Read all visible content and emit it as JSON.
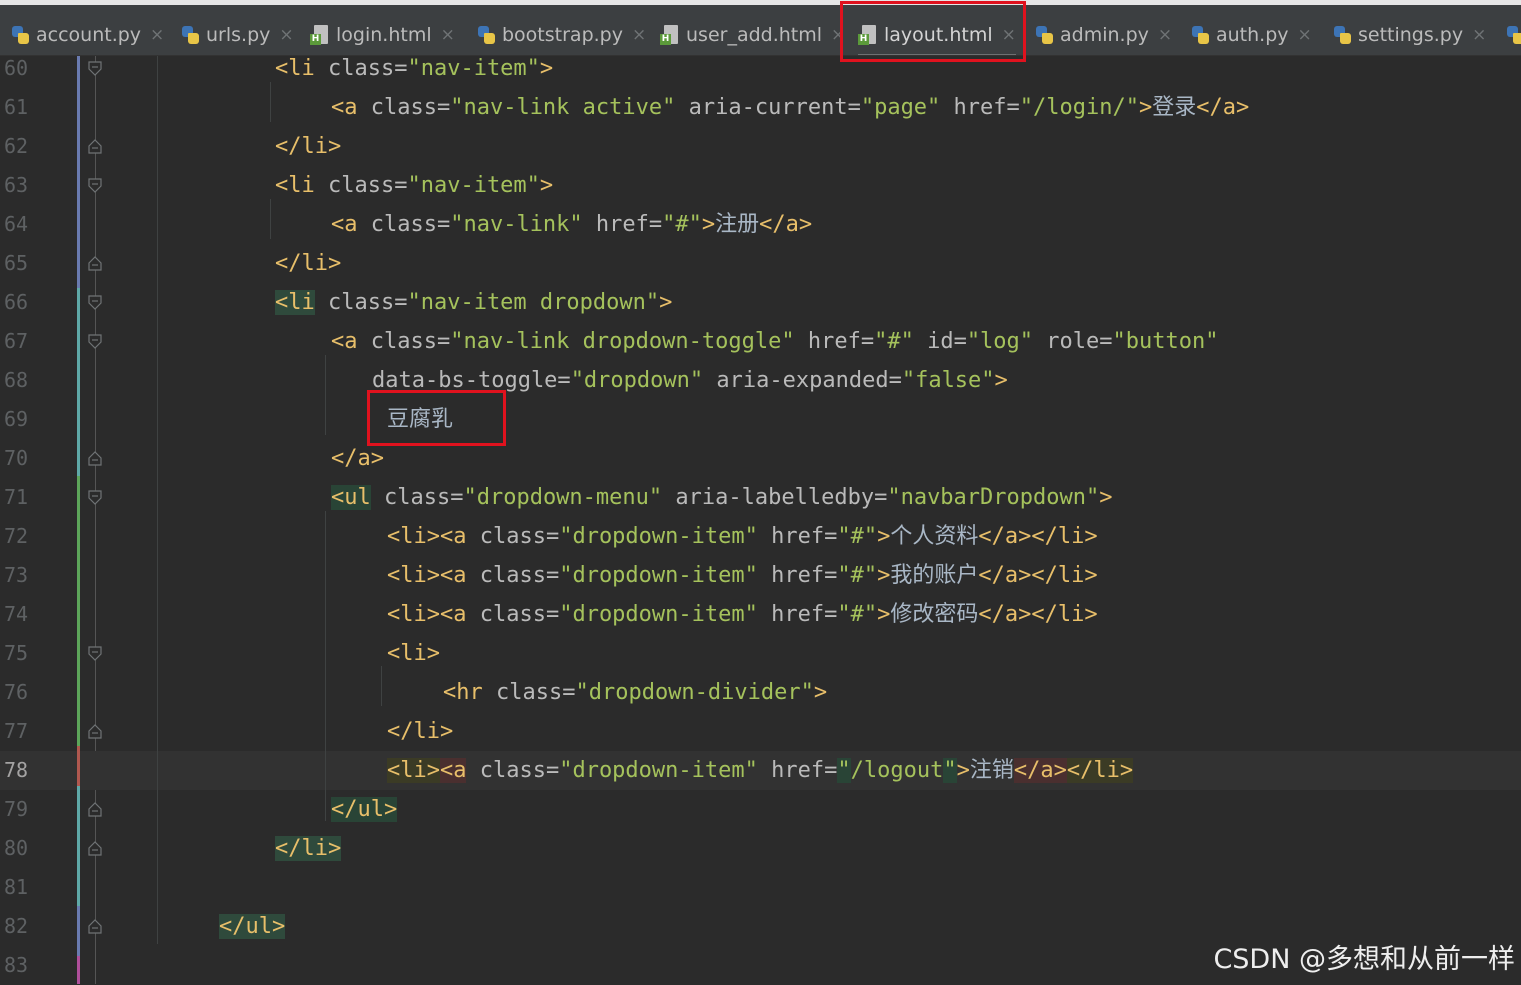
{
  "tabs": [
    {
      "label": "account.py",
      "icon": "python-file-icon",
      "active": false
    },
    {
      "label": "urls.py",
      "icon": "python-file-icon",
      "active": false
    },
    {
      "label": "login.html",
      "icon": "html-file-icon",
      "active": false
    },
    {
      "label": "bootstrap.py",
      "icon": "python-file-icon",
      "active": false
    },
    {
      "label": "user_add.html",
      "icon": "html-file-icon",
      "active": false
    },
    {
      "label": "layout.html",
      "icon": "html-file-icon",
      "active": true
    },
    {
      "label": "admin.py",
      "icon": "python-file-icon",
      "active": false
    },
    {
      "label": "auth.py",
      "icon": "python-file-icon",
      "active": false
    },
    {
      "label": "settings.py",
      "icon": "python-file-icon",
      "active": false
    }
  ],
  "tab_close_glyph": "×",
  "current_line": "78",
  "colors": {
    "highlight_box": "#e0121e",
    "tag": "#e8bf6a",
    "attribute_value": "#a5c25c",
    "attribute": "#bababa"
  },
  "lines": [
    {
      "num": "60",
      "tokens": [
        [
          "tag",
          "<li"
        ],
        [
          "attr",
          " class="
        ],
        [
          "val",
          "\"nav-item\""
        ],
        [
          "tag",
          ">"
        ]
      ]
    },
    {
      "num": "61",
      "tokens": [
        [
          "tag",
          "<a"
        ],
        [
          "attr",
          " class="
        ],
        [
          "val",
          "\"nav-link active\""
        ],
        [
          "attr",
          " aria-current="
        ],
        [
          "val",
          "\"page\""
        ],
        [
          "attr",
          " href="
        ],
        [
          "val",
          "\"/login/\""
        ],
        [
          "tag",
          ">"
        ],
        [
          "txt",
          "登录"
        ],
        [
          "tag",
          "</a>"
        ]
      ]
    },
    {
      "num": "62",
      "tokens": [
        [
          "tag",
          "</li>"
        ]
      ]
    },
    {
      "num": "63",
      "tokens": [
        [
          "tag",
          "<li"
        ],
        [
          "attr",
          " class="
        ],
        [
          "val",
          "\"nav-item\""
        ],
        [
          "tag",
          ">"
        ]
      ]
    },
    {
      "num": "64",
      "tokens": [
        [
          "tag",
          "<a"
        ],
        [
          "attr",
          " class="
        ],
        [
          "val",
          "\"nav-link\""
        ],
        [
          "attr",
          " href="
        ],
        [
          "val",
          "\"#\""
        ],
        [
          "tag",
          ">"
        ],
        [
          "txt",
          "注册"
        ],
        [
          "tag",
          "</a>"
        ]
      ]
    },
    {
      "num": "65",
      "tokens": [
        [
          "tag",
          "</li>"
        ]
      ]
    },
    {
      "num": "66",
      "tokens": [
        [
          "tagbg",
          "<li"
        ],
        [
          "attr",
          " class="
        ],
        [
          "val",
          "\"nav-item dropdown\""
        ],
        [
          "tag",
          ">"
        ]
      ]
    },
    {
      "num": "67",
      "tokens": [
        [
          "tag",
          "<a"
        ],
        [
          "attr",
          " class="
        ],
        [
          "val",
          "\"nav-link dropdown-toggle\""
        ],
        [
          "attr",
          " href="
        ],
        [
          "val",
          "\"#\""
        ],
        [
          "attr",
          " id="
        ],
        [
          "val",
          "\"log\""
        ],
        [
          "attr",
          " role="
        ],
        [
          "val",
          "\"button\""
        ]
      ]
    },
    {
      "num": "68",
      "tokens": [
        [
          "attr",
          "data-bs-toggle="
        ],
        [
          "val",
          "\"dropdown\""
        ],
        [
          "attr",
          " aria-expanded="
        ],
        [
          "val",
          "\"false\""
        ],
        [
          "tag",
          ">"
        ]
      ]
    },
    {
      "num": "69",
      "tokens": [
        [
          "txt",
          "豆腐乳"
        ]
      ]
    },
    {
      "num": "70",
      "tokens": [
        [
          "tag",
          "</a>"
        ]
      ]
    },
    {
      "num": "71",
      "tokens": [
        [
          "tagbg-g",
          "<ul"
        ],
        [
          "attr",
          " class="
        ],
        [
          "val",
          "\"dropdown-menu\""
        ],
        [
          "attr",
          " aria-labelledby="
        ],
        [
          "val",
          "\"navbarDropdown\""
        ],
        [
          "tag",
          ">"
        ]
      ]
    },
    {
      "num": "72",
      "tokens": [
        [
          "tag",
          "<li><a"
        ],
        [
          "attr",
          " class="
        ],
        [
          "val",
          "\"dropdown-item\""
        ],
        [
          "attr",
          " href="
        ],
        [
          "val",
          "\"#\""
        ],
        [
          "tag",
          ">"
        ],
        [
          "txt",
          "个人资料"
        ],
        [
          "tag",
          "</a></li>"
        ]
      ]
    },
    {
      "num": "73",
      "tokens": [
        [
          "tag",
          "<li><a"
        ],
        [
          "attr",
          " class="
        ],
        [
          "val",
          "\"dropdown-item\""
        ],
        [
          "attr",
          " href="
        ],
        [
          "val",
          "\"#\""
        ],
        [
          "tag",
          ">"
        ],
        [
          "txt",
          "我的账户"
        ],
        [
          "tag",
          "</a></li>"
        ]
      ]
    },
    {
      "num": "74",
      "tokens": [
        [
          "tag",
          "<li><a"
        ],
        [
          "attr",
          " class="
        ],
        [
          "val",
          "\"dropdown-item\""
        ],
        [
          "attr",
          " href="
        ],
        [
          "val",
          "\"#\""
        ],
        [
          "tag",
          ">"
        ],
        [
          "txt",
          "修改密码"
        ],
        [
          "tag",
          "</a></li>"
        ]
      ]
    },
    {
      "num": "75",
      "tokens": [
        [
          "tag",
          "<li>"
        ]
      ]
    },
    {
      "num": "76",
      "tokens": [
        [
          "tag",
          "<hr"
        ],
        [
          "attr",
          " class="
        ],
        [
          "val",
          "\"dropdown-divider\""
        ],
        [
          "tag",
          ">"
        ]
      ]
    },
    {
      "num": "77",
      "tokens": [
        [
          "tag",
          "</li>"
        ]
      ]
    },
    {
      "num": "78",
      "tokens": [
        [
          "hl-y",
          "<li>"
        ],
        [
          "hl-r",
          "<a"
        ],
        [
          "attr",
          " class="
        ],
        [
          "val",
          "\"dropdown-item\""
        ],
        [
          "attr",
          " href="
        ],
        [
          "hl-g-val",
          "\""
        ],
        [
          "val",
          "/logout"
        ],
        [
          "hl-g-val",
          "\""
        ],
        [
          "tag",
          ">"
        ],
        [
          "txt",
          "注销"
        ],
        [
          "hl-r",
          "</a>"
        ],
        [
          "hl-y",
          "</li>"
        ]
      ]
    },
    {
      "num": "79",
      "tokens": [
        [
          "tagbg-g",
          "</ul>"
        ]
      ]
    },
    {
      "num": "80",
      "tokens": [
        [
          "tagbg",
          "</li>"
        ]
      ]
    },
    {
      "num": "81",
      "tokens": []
    },
    {
      "num": "82",
      "tokens": [
        [
          "tagbg",
          "</ul>"
        ]
      ]
    },
    {
      "num": "83",
      "tokens": []
    }
  ],
  "watermark": "CSDN @多想和从前一样"
}
